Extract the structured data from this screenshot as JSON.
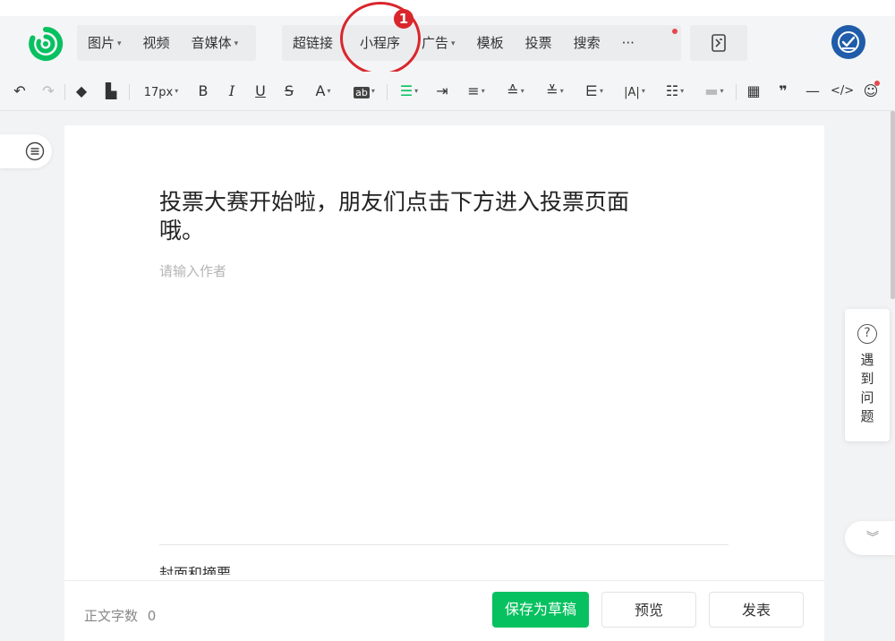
{
  "topbar": {
    "menu_group_1": [
      {
        "label": "图片",
        "has_dropdown": true
      },
      {
        "label": "视频",
        "has_dropdown": false
      },
      {
        "label": "音媒体",
        "has_dropdown": true
      }
    ],
    "menu_group_2": [
      {
        "label": "超链接",
        "has_dropdown": false
      },
      {
        "label": "小程序",
        "has_dropdown": false
      },
      {
        "label": "广告",
        "has_dropdown": true
      },
      {
        "label": "模板",
        "has_dropdown": false
      },
      {
        "label": "投票",
        "has_dropdown": false
      },
      {
        "label": "搜索",
        "has_dropdown": false
      },
      {
        "label": "···",
        "has_dropdown": false
      }
    ],
    "annotation_number": "1",
    "accent_color": "#07c160",
    "annotation_color": "#d9262c"
  },
  "format_toolbar": {
    "font_size": "17px",
    "bold": "B",
    "italic": "I",
    "underline": "U",
    "strike": "S",
    "font_color": "A",
    "bg_color": "ab",
    "lrl": "|A|",
    "quote": "❞",
    "code": "</>"
  },
  "editor": {
    "title": "投票大赛开始啦，朋友们点击下方进入投票页面哦。",
    "author_placeholder": "请输入作者",
    "cover_label": "封面和摘要"
  },
  "bottombar": {
    "word_count_label": "正文字数",
    "word_count_value": "0",
    "save_draft": "保存为草稿",
    "preview": "预览",
    "publish": "发表"
  },
  "help": {
    "icon": "?",
    "label_chars": [
      "遇",
      "到",
      "问",
      "题"
    ]
  }
}
